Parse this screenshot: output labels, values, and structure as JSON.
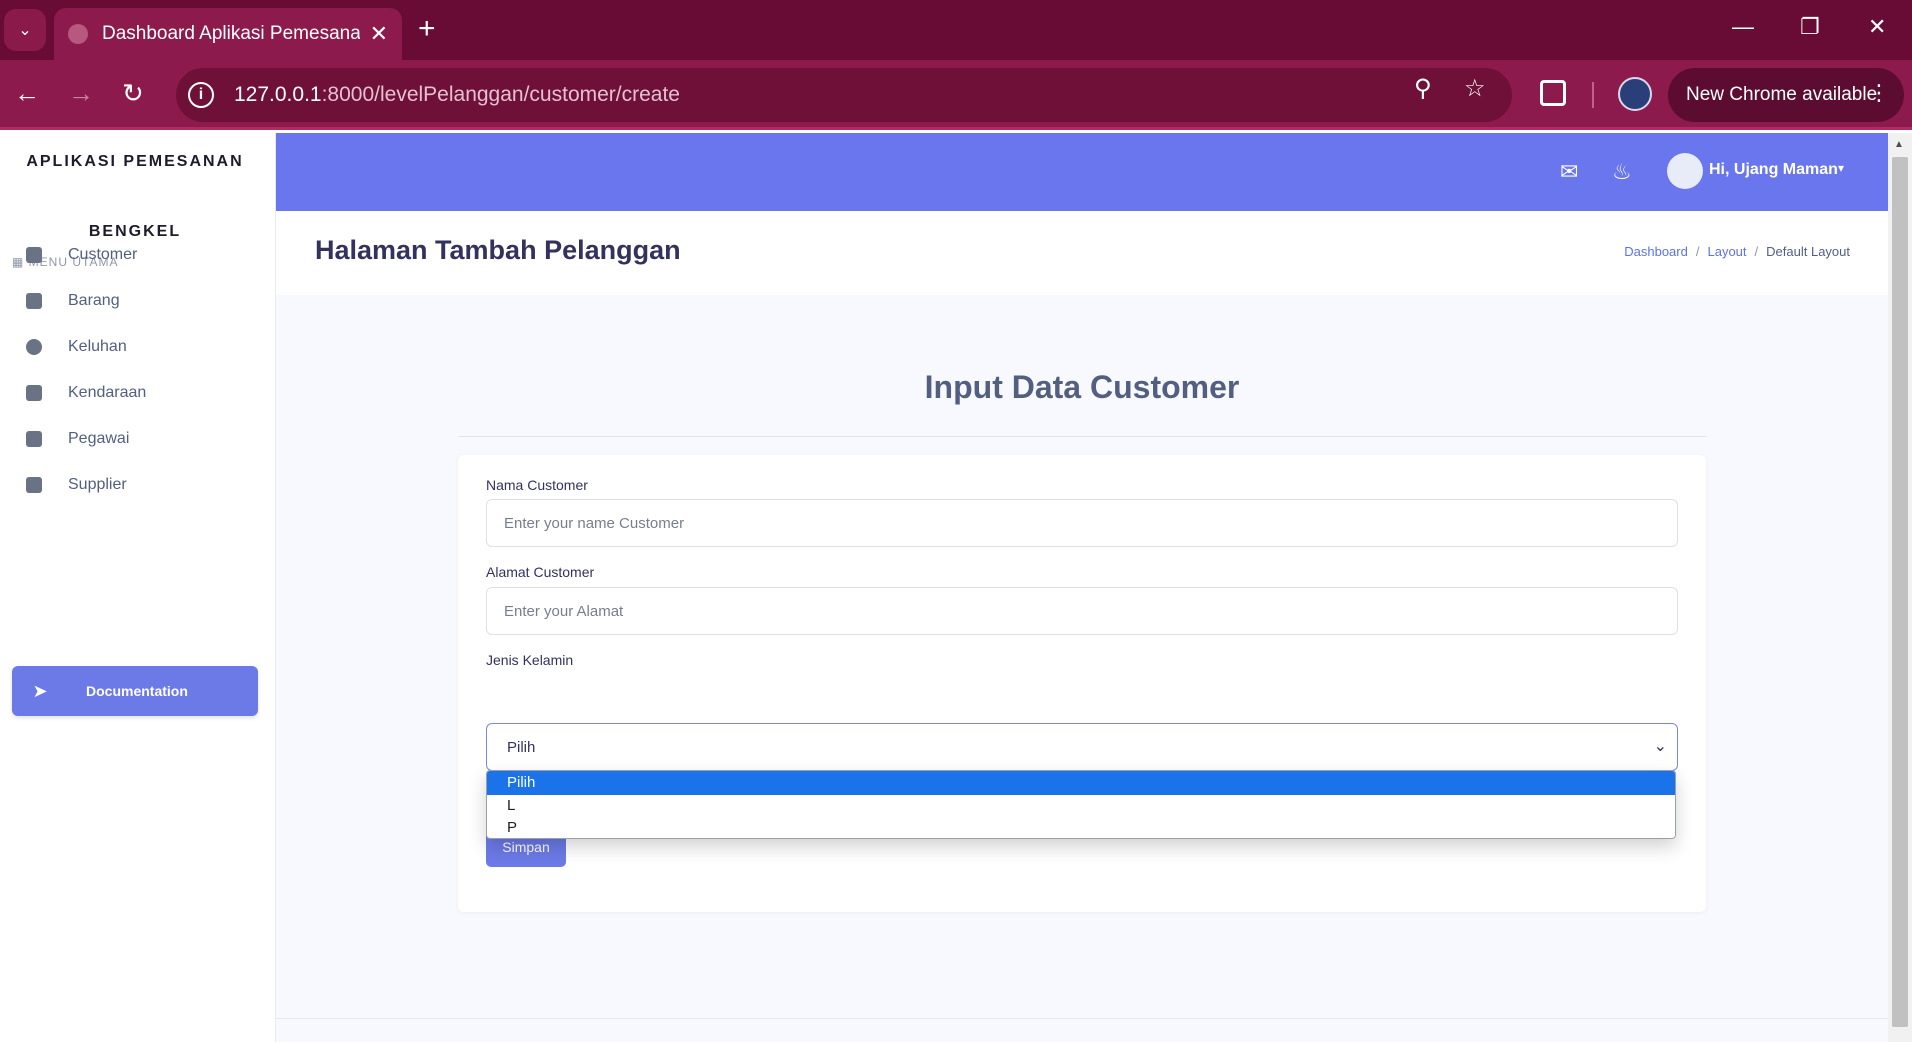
{
  "browser": {
    "tab_title": "Dashboard Aplikasi Pemesanan",
    "url_host": "127.0.0.1",
    "url_path": ":8000/levelPelanggan/customer/create",
    "update_label": "New Chrome available"
  },
  "sidebar": {
    "brand_line1": "APLIKASI PEMESANAN",
    "brand_line2": "BENGKEL",
    "menu_heading": "MENU UTAMA",
    "items": [
      {
        "label": "Customer",
        "icon": "users-icon"
      },
      {
        "label": "Barang",
        "icon": "box-icon"
      },
      {
        "label": "Keluhan",
        "icon": "exclamation-icon"
      },
      {
        "label": "Kendaraan",
        "icon": "car-icon"
      },
      {
        "label": "Pegawai",
        "icon": "user-tie-icon"
      },
      {
        "label": "Supplier",
        "icon": "truck-icon"
      }
    ],
    "doc_button": "Documentation"
  },
  "topbar": {
    "user_greeting": "Hi, Ujang Maman"
  },
  "header": {
    "title": "Halaman Tambah Pelanggan",
    "breadcrumb": [
      "Dashboard",
      "Layout",
      "Default Layout"
    ]
  },
  "form": {
    "heading": "Input Data Customer",
    "nama_label": "Nama Customer",
    "nama_placeholder": "Enter your name Customer",
    "alamat_label": "Alamat Customer",
    "alamat_placeholder": "Enter your Alamat",
    "jk_label": "Jenis Kelamin",
    "jk_selected": "Pilih",
    "jk_options": [
      "Pilih",
      "L",
      "P"
    ],
    "submit_label": "Simpan"
  },
  "colors": {
    "chrome_frame": "#680c35",
    "accent": "#6a76ed",
    "dropdown_highlight": "#1a73e8"
  }
}
